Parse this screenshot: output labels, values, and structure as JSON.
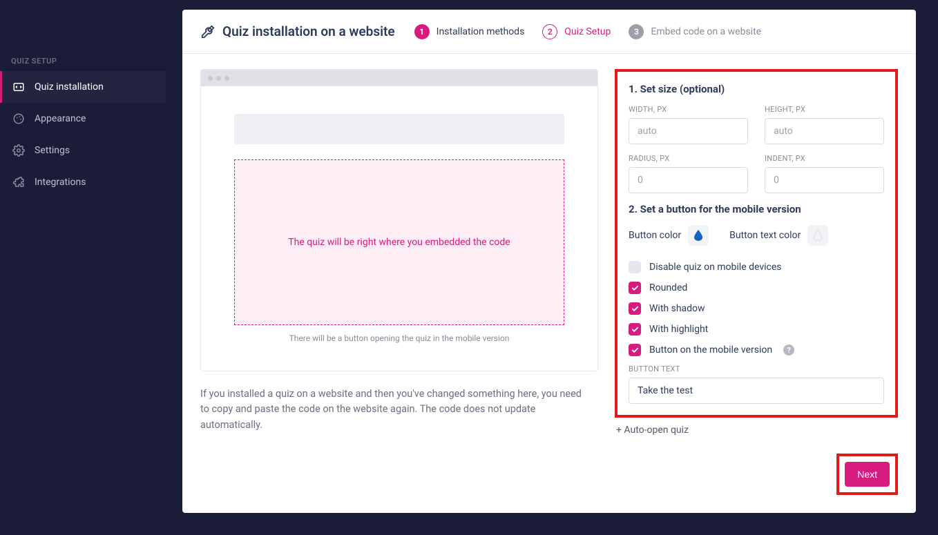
{
  "sidebar": {
    "section_title": "QUIZ SETUP",
    "items": [
      {
        "label": "Quiz installation"
      },
      {
        "label": "Appearance"
      },
      {
        "label": "Settings"
      },
      {
        "label": "Integrations"
      }
    ]
  },
  "header": {
    "title": "Quiz installation on a website",
    "steps": [
      {
        "num": "1",
        "label": "Installation methods"
      },
      {
        "num": "2",
        "label": "Quiz Setup"
      },
      {
        "num": "3",
        "label": "Embed code on a website"
      }
    ]
  },
  "preview": {
    "embed_text": "The quiz will be right where you embedded the code",
    "caption": "There will be a button opening the quiz in the mobile version"
  },
  "note": "If you installed a quiz on a website and then you've changed something here, you need to copy and paste the code on the website again. The code does not update automatically.",
  "settings": {
    "size": {
      "heading": "1. Set size (optional)",
      "width_label": "WIDTH, PX",
      "width_placeholder": "auto",
      "width_value": "",
      "height_label": "HEIGHT, PX",
      "height_placeholder": "auto",
      "height_value": "",
      "radius_label": "RADIUS, PX",
      "radius_placeholder": "0",
      "radius_value": "",
      "indent_label": "INDENT, PX",
      "indent_placeholder": "0",
      "indent_value": ""
    },
    "mobile": {
      "heading": "2. Set a button for the mobile version",
      "button_color_label": "Button color",
      "button_color": "#1565c0",
      "button_text_color_label": "Button text color",
      "button_text_color": "#ffffff",
      "checks": {
        "disable_mobile": "Disable quiz on mobile devices",
        "rounded": "Rounded",
        "with_shadow": "With shadow",
        "with_highlight": "With highlight",
        "button_mobile": "Button on the mobile version"
      },
      "button_text_label": "BUTTON TEXT",
      "button_text_value": "Take the test"
    },
    "auto_open": "+ Auto-open quiz"
  },
  "actions": {
    "next": "Next"
  }
}
